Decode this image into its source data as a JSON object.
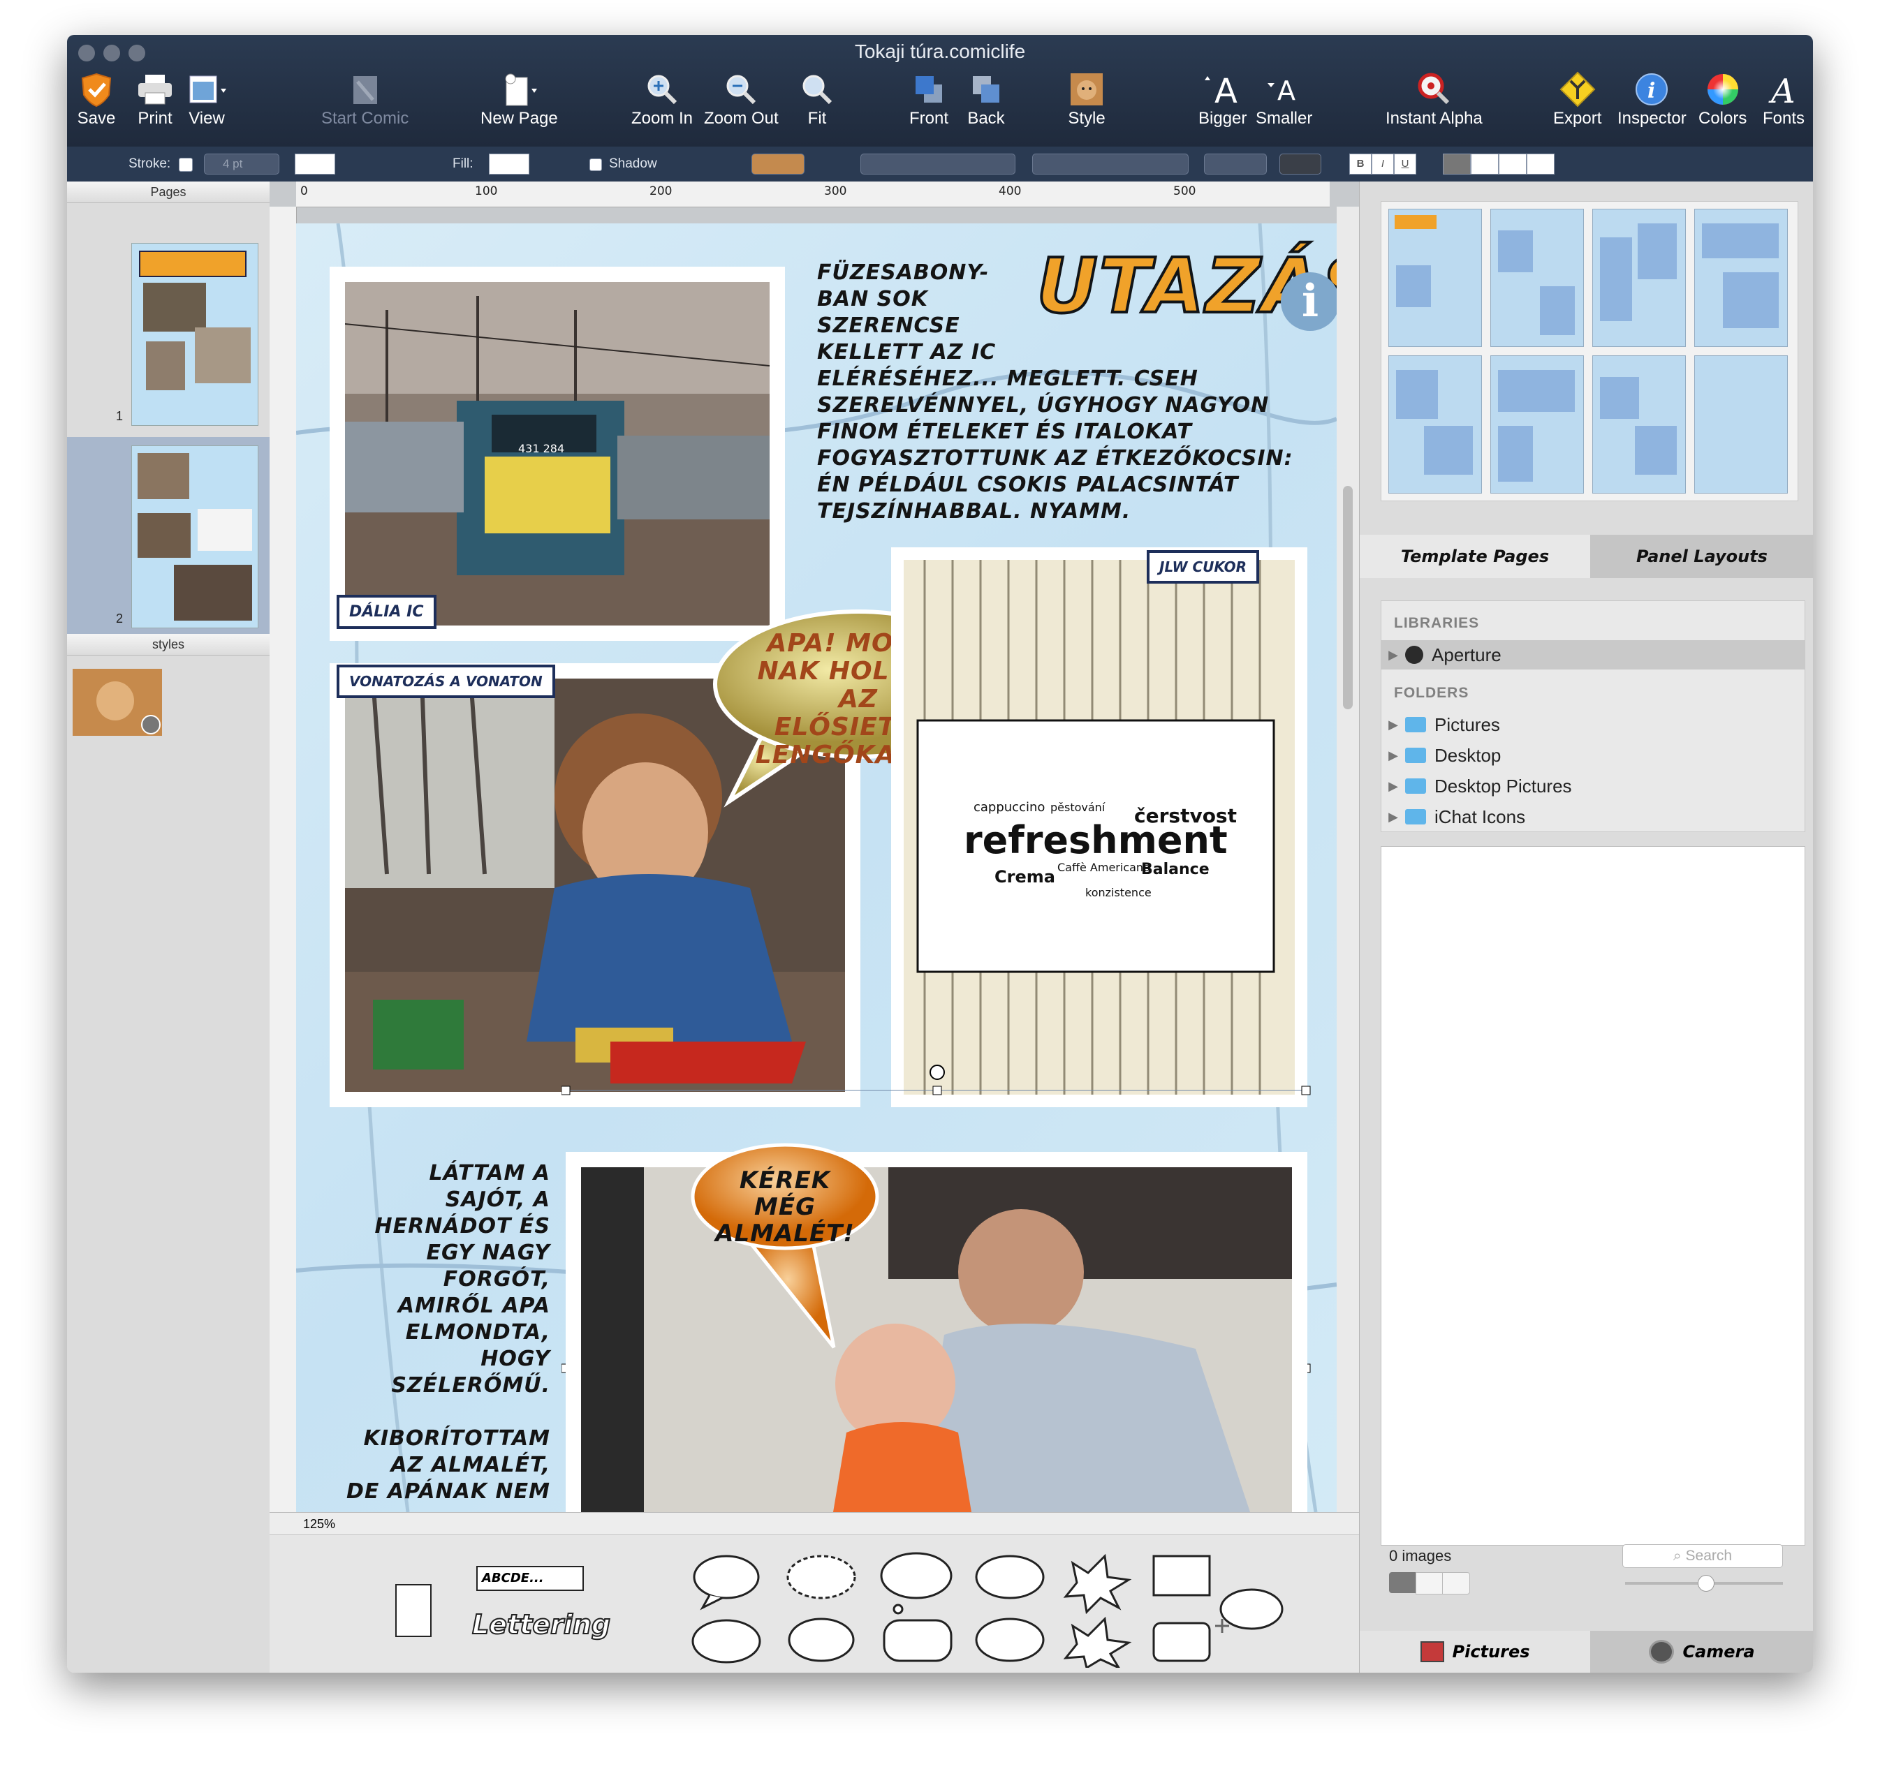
{
  "window": {
    "title": "Tokaji túra.comiclife"
  },
  "toolbar": {
    "save": "Save",
    "print": "Print",
    "view": "View",
    "start_comic": "Start Comic",
    "new_page": "New Page",
    "zoom_in": "Zoom In",
    "zoom_out": "Zoom Out",
    "fit": "Fit",
    "front": "Front",
    "back": "Back",
    "style": "Style",
    "bigger": "Bigger",
    "smaller": "Smaller",
    "instant_alpha": "Instant Alpha",
    "export": "Export",
    "inspector": "Inspector",
    "colors": "Colors",
    "fonts": "Fonts"
  },
  "format_bar": {
    "stroke_label": "Stroke:",
    "stroke_size": "4 pt",
    "fill_label": "Fill:",
    "shadow_label": "Shadow",
    "bold": "B",
    "italic": "I",
    "underline": "U"
  },
  "left_sidebar": {
    "pages_header": "Pages",
    "page1_number": "1",
    "page2_number": "2",
    "styles_header": "styles"
  },
  "ruler": {
    "h": [
      "0",
      "100",
      "200",
      "300",
      "400",
      "500"
    ]
  },
  "page": {
    "title_art": "UTAZÁS",
    "narration1": [
      "Füzesabony-",
      "ban sok",
      "szerencse",
      "kellett az IC",
      "eléréséhez... meglett. Cseh",
      "szerelvénnyel, úgyhogy nagyon",
      "finom ételeket és italokat",
      "fogyasztottunk az étkezőkocsin:",
      "én például csokis palacsintát",
      "tejszínhabbal. Nyamm."
    ],
    "caption1": "Dália IC",
    "caption2": "Vonatozás a vonaton",
    "caption3": "JLW Cukor",
    "balloon1": [
      "Apa! Molly-",
      "nak hol van az",
      "elősietési",
      "lengőkarja?"
    ],
    "balloon2": [
      "Kérek",
      "még",
      "almalét!"
    ],
    "locomotive_number": "431 284",
    "word_cloud": [
      "cappuccino",
      "pěstování",
      "čerstvost",
      "refreshment",
      "Crema",
      "Balance",
      "Caffè Americano",
      "konzistence"
    ],
    "narration2": [
      "Láttam a",
      "Sajót, a",
      "Hernádot és",
      "egy nagy",
      "forgót,",
      "amiről apa",
      "elmondta,",
      "hogy",
      "szélerőmű.",
      "",
      "Kiborítottam",
      "az almalét,",
      "de apának nem"
    ]
  },
  "zoom": {
    "level": "125%"
  },
  "balloon_palette": {
    "caption_sample": "ABCDE...",
    "lettering": "Lettering"
  },
  "right_panel": {
    "tabs": {
      "template_pages": "Template Pages",
      "panel_layouts": "Panel Layouts"
    },
    "libraries_header": "LIBRARIES",
    "libraries": [
      "Aperture"
    ],
    "folders_header": "FOLDERS",
    "folders": [
      "Pictures",
      "Desktop",
      "Desktop Pictures",
      "iChat Icons"
    ],
    "image_count": "0 images",
    "search_placeholder": "Search",
    "bottom_tabs": {
      "pictures": "Pictures",
      "camera": "Camera"
    }
  },
  "colors": {
    "titlebar": "#1f2a3c",
    "caption_border": "#1d2e5a",
    "page_bg": "#c6e2f3",
    "balloon_gold": "#b8a447",
    "balloon_orange": "#e07a10",
    "title_art_orange": "#f0a22a"
  }
}
